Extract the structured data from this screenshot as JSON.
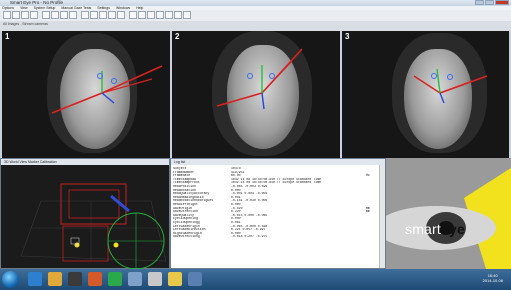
{
  "window": {
    "title": "Smart Eye Pro - No Profile"
  },
  "menu": [
    "Options",
    "View",
    "System Setup",
    "Manual Gaze Tests",
    "Settings",
    "Windows",
    "Help"
  ],
  "camera_strip_label": "All images - Stream cameras",
  "cameras": [
    {
      "num": "1"
    },
    {
      "num": "2"
    },
    {
      "num": "3"
    }
  ],
  "panel3d": {
    "title": "3D World View   Marker Calibration"
  },
  "log": {
    "title": "Log list",
    "rows": [
      [
        "Subject",
        "1047d",
        ""
      ],
      [
        "FrameNumber",
        "419,951",
        ""
      ],
      [
        "FrameRate",
        "60.00",
        "Hz"
      ],
      [
        "TimeStampRaw",
        "1042 1s 08 16:40:08.840  TT Europe Standard Time",
        ""
      ],
      [
        "TimeStampFront",
        "1042 1s 08 16:40:08.840  TT Europe Standard Time",
        ""
      ],
      [
        "HeadPosition",
        "-0.085  -0.003   0.596",
        ""
      ],
      [
        "HeadRotation",
        "0.000",
        ""
      ],
      [
        "HeadQualityAccuracy",
        "-0.001   0.004  -0.004",
        ""
      ],
      [
        "HeadHeadingRatio",
        "0.001",
        ""
      ],
      [
        "HeadRotationRodrigues",
        "-0.131  -0.030   0.000",
        ""
      ],
      [
        "HeadLeftRight",
        "0.000",
        ""
      ],
      [
        "GazeOrigin",
        "-0.020",
        "mm"
      ],
      [
        "GazeDirection",
        "0.220",
        "mm"
      ],
      [
        "GazeQuality",
        "-0.015   0.000  -0.065",
        ""
      ],
      [
        "EyelidOpening",
        "0.000",
        ""
      ],
      [
        "EyelidOpeningQ",
        "0.061",
        ""
      ],
      [
        "LeftGazeOrigin",
        "-0.065  -0.000   0.560",
        ""
      ],
      [
        "LeftGazeDirection",
        "0.221   0.057  -0.997",
        ""
      ],
      [
        "RightGazeOrigin",
        "0.000",
        ""
      ],
      [
        "GazeDirectionQ",
        "-0.018   0.207  -0.975",
        ""
      ]
    ]
  },
  "logo": {
    "smart": "smart",
    "eye": "eye"
  },
  "clock": {
    "time": "16:40",
    "date": "2014-10-08"
  }
}
